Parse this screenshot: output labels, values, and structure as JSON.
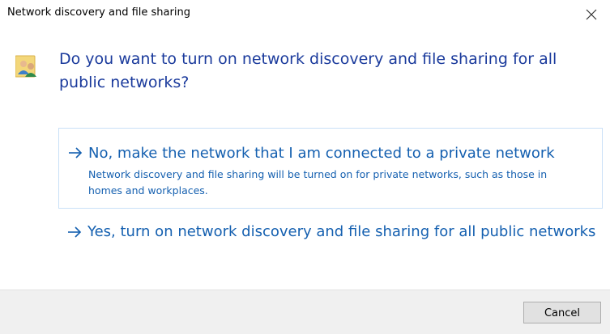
{
  "window": {
    "title": "Network discovery and file sharing",
    "close_icon": "close-icon"
  },
  "dialog": {
    "icon": "network-users-icon",
    "question": "Do you want to turn on network discovery and file sharing for all public networks?",
    "options": [
      {
        "icon": "arrow-right-icon",
        "title": "No, make the network that I am connected to a private network",
        "description": "Network discovery and file sharing will be turned on for private networks, such as those in homes and workplaces."
      },
      {
        "icon": "arrow-right-icon",
        "title": "Yes, turn on network discovery and file sharing for all public networks",
        "description": ""
      }
    ]
  },
  "footer": {
    "cancel_label": "Cancel"
  },
  "colors": {
    "question": "#1a3a9c",
    "link": "#1560b0",
    "option_border": "#c9e0f7",
    "footer_bg": "#f0f0f0"
  }
}
